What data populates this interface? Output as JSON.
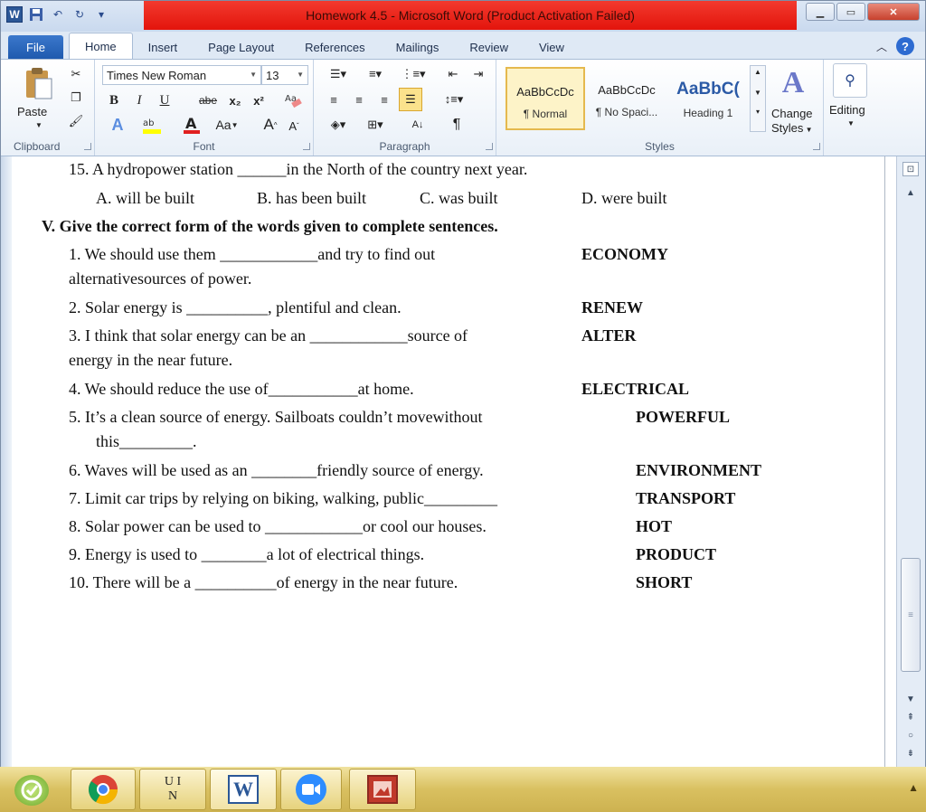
{
  "window": {
    "title": "Homework 4.5  -  Microsoft Word (Product Activation Failed)",
    "title_bar_color": "#e8190f",
    "logo_letter": "W"
  },
  "tabs": [
    "File",
    "Home",
    "Insert",
    "Page Layout",
    "References",
    "Mailings",
    "Review",
    "View"
  ],
  "ribbon": {
    "clipboard": {
      "label": "Clipboard",
      "paste": "Paste"
    },
    "font": {
      "label": "Font",
      "name": "Times New Roman",
      "size": "13",
      "bold": "B",
      "italic": "I",
      "underline": "U",
      "strike": "abe",
      "subscript": "x₂",
      "superscript": "x²",
      "grow": "A",
      "shrink": "A",
      "change_case": "Aa"
    },
    "paragraph": {
      "label": "Paragraph",
      "pilcrow": "¶"
    },
    "styles": {
      "label": "Styles",
      "items": [
        {
          "preview": "AaBbCcDc",
          "name": "¶ Normal"
        },
        {
          "preview": "AaBbCcDc",
          "name": "¶ No Spaci..."
        },
        {
          "preview": "AaBbC(",
          "name": "Heading 1"
        }
      ],
      "change_styles_line1": "Change",
      "change_styles_line2": "Styles"
    },
    "editing": {
      "label": "Editing"
    }
  },
  "document": {
    "q15": "15. A hydropower station             ______in the North of the country next year.",
    "q15_options": [
      "A. will be built",
      "B. has been built",
      "C. was built",
      "D. were built"
    ],
    "section_heading": "V.  Give the correct form of the words given to complete sentences.",
    "items": [
      {
        "line1": "1.   We should use them ____________and try to find out",
        "line2": "alternativesources of power.",
        "keyword": "ECONOMY"
      },
      {
        "line1": "2.   Solar energy is __________, plentiful and clean.",
        "line2": "",
        "keyword": "RENEW"
      },
      {
        "line1": "3.   I think that solar energy can be an ____________source of",
        "line2": "energy in the near future.",
        "keyword": "ALTER"
      },
      {
        "line1": "4.   We should reduce the use of___________at home.",
        "line2": "",
        "keyword": "ELECTRICAL"
      },
      {
        "line1": "5.   It’s a clean source of energy. Sailboats couldn’t movewithout",
        "line2": "this_________.",
        "keyword": "POWERFUL"
      },
      {
        "line1": "6.   Waves will be used as an ________friendly source of energy.",
        "line2": "",
        "keyword": "ENVIRONMENT"
      },
      {
        "line1": "7.   Limit car trips by relying on biking, walking, public_________",
        "line2": "",
        "keyword": "TRANSPORT"
      },
      {
        "line1": "8.   Solar power can be used to ____________or cool our houses.",
        "line2": "",
        "keyword": "HOT"
      },
      {
        "line1": "9.   Energy is used to ________a lot of electrical things.",
        "line2": "",
        "keyword": "PRODUCT"
      },
      {
        "line1": "10. There will be a __________of energy in the near future.",
        "line2": "",
        "keyword": "SHORT"
      }
    ]
  },
  "taskbar": {
    "ime_line1": "U I",
    "ime_line2": "N",
    "word_letter": "W"
  }
}
